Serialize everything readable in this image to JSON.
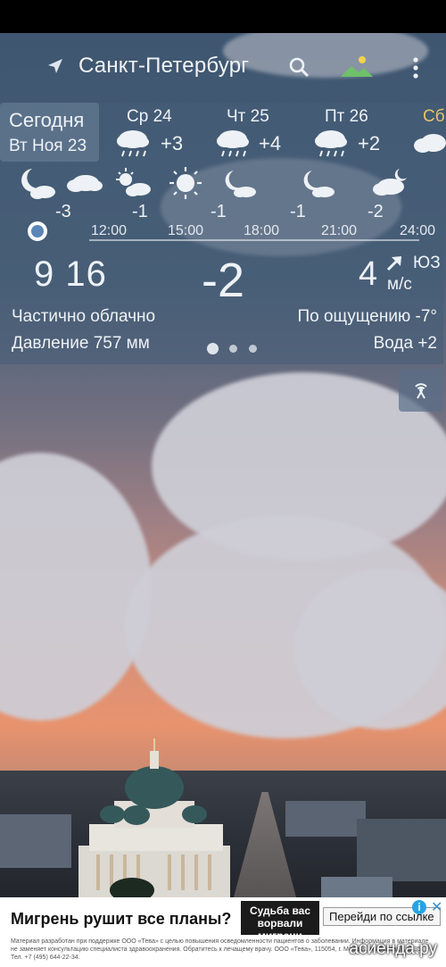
{
  "header": {
    "city": "Санкт-Петербург"
  },
  "today": {
    "label": "Сегодня",
    "date": "Вт Ноя 23"
  },
  "days": [
    {
      "name": "Ср 24",
      "temp": "+3"
    },
    {
      "name": "Чт 25",
      "temp": "+4"
    },
    {
      "name": "Пт 26",
      "temp": "+2"
    },
    {
      "name": "Сб",
      "temp": ""
    }
  ],
  "hourly": {
    "temps": [
      "-3",
      "-1",
      "-1",
      "-1",
      "-2"
    ],
    "times": [
      "12:00",
      "15:00",
      "18:00",
      "21:00",
      "24:00"
    ],
    "icons": [
      "moon-cloud-icon",
      "cloud-icon",
      "sun-cloud-icon",
      "sun-icon",
      "moon-cloud-icon",
      "moon-cloud-icon",
      "cloud-moon-icon"
    ]
  },
  "current": {
    "time": "9 16",
    "temp": "-2",
    "wind_speed": "4",
    "wind_dir": "ЮЗ",
    "wind_unit": "м/с",
    "condition": "Частично облачно",
    "feels_like": "По ощущению -7°",
    "pressure": "Давление 757 мм",
    "water": "Вода +2"
  },
  "pager": {
    "pages": 3,
    "active": 1
  },
  "ad": {
    "title": "Мигрень рушит все планы?",
    "logo_text": "Судьба вас ворвали мигрени",
    "cta": "Перейди по ссылке",
    "info": "i",
    "close": "✕",
    "small_text": "Материал разработан при поддержке ООО «Тева» с целью повышения осведомленности пациентов о заболевании. Информация в материале не заменяет консультацию специалиста здравоохранения. Обратитесь к лечащему врачу. ООО «Тева», 115054, г. Москва, ул. Валовая, д. 35. Тел. +7 (495) 644-22-34."
  },
  "watermark": "асиенда.ру",
  "colors": {
    "accent": "#e7c46a",
    "now_dot": "#5a86b8",
    "ad_info": "#26a5e1"
  }
}
